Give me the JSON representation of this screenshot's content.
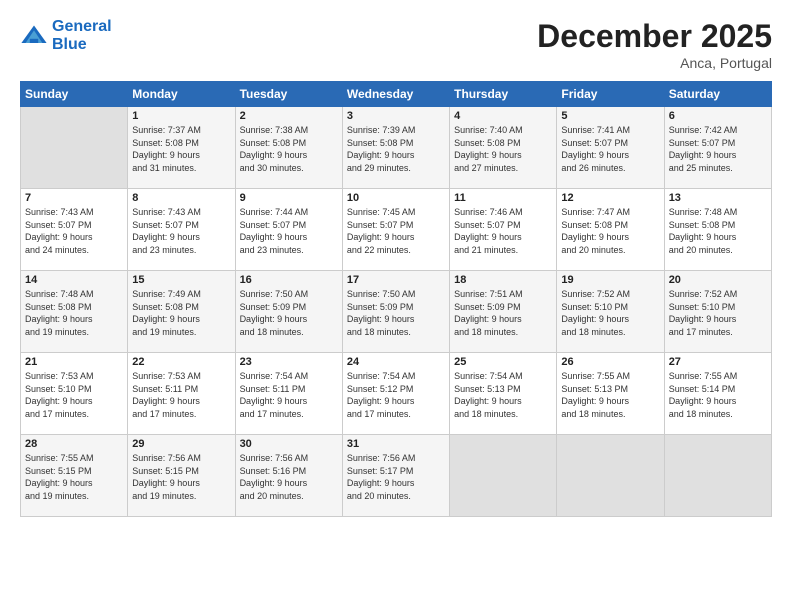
{
  "header": {
    "logo_line1": "General",
    "logo_line2": "Blue",
    "month": "December 2025",
    "location": "Anca, Portugal"
  },
  "weekdays": [
    "Sunday",
    "Monday",
    "Tuesday",
    "Wednesday",
    "Thursday",
    "Friday",
    "Saturday"
  ],
  "weeks": [
    [
      {
        "day": "",
        "info": ""
      },
      {
        "day": "1",
        "info": "Sunrise: 7:37 AM\nSunset: 5:08 PM\nDaylight: 9 hours\nand 31 minutes."
      },
      {
        "day": "2",
        "info": "Sunrise: 7:38 AM\nSunset: 5:08 PM\nDaylight: 9 hours\nand 30 minutes."
      },
      {
        "day": "3",
        "info": "Sunrise: 7:39 AM\nSunset: 5:08 PM\nDaylight: 9 hours\nand 29 minutes."
      },
      {
        "day": "4",
        "info": "Sunrise: 7:40 AM\nSunset: 5:08 PM\nDaylight: 9 hours\nand 27 minutes."
      },
      {
        "day": "5",
        "info": "Sunrise: 7:41 AM\nSunset: 5:07 PM\nDaylight: 9 hours\nand 26 minutes."
      },
      {
        "day": "6",
        "info": "Sunrise: 7:42 AM\nSunset: 5:07 PM\nDaylight: 9 hours\nand 25 minutes."
      }
    ],
    [
      {
        "day": "7",
        "info": "Sunrise: 7:43 AM\nSunset: 5:07 PM\nDaylight: 9 hours\nand 24 minutes."
      },
      {
        "day": "8",
        "info": "Sunrise: 7:43 AM\nSunset: 5:07 PM\nDaylight: 9 hours\nand 23 minutes."
      },
      {
        "day": "9",
        "info": "Sunrise: 7:44 AM\nSunset: 5:07 PM\nDaylight: 9 hours\nand 23 minutes."
      },
      {
        "day": "10",
        "info": "Sunrise: 7:45 AM\nSunset: 5:07 PM\nDaylight: 9 hours\nand 22 minutes."
      },
      {
        "day": "11",
        "info": "Sunrise: 7:46 AM\nSunset: 5:07 PM\nDaylight: 9 hours\nand 21 minutes."
      },
      {
        "day": "12",
        "info": "Sunrise: 7:47 AM\nSunset: 5:08 PM\nDaylight: 9 hours\nand 20 minutes."
      },
      {
        "day": "13",
        "info": "Sunrise: 7:48 AM\nSunset: 5:08 PM\nDaylight: 9 hours\nand 20 minutes."
      }
    ],
    [
      {
        "day": "14",
        "info": "Sunrise: 7:48 AM\nSunset: 5:08 PM\nDaylight: 9 hours\nand 19 minutes."
      },
      {
        "day": "15",
        "info": "Sunrise: 7:49 AM\nSunset: 5:08 PM\nDaylight: 9 hours\nand 19 minutes."
      },
      {
        "day": "16",
        "info": "Sunrise: 7:50 AM\nSunset: 5:09 PM\nDaylight: 9 hours\nand 18 minutes."
      },
      {
        "day": "17",
        "info": "Sunrise: 7:50 AM\nSunset: 5:09 PM\nDaylight: 9 hours\nand 18 minutes."
      },
      {
        "day": "18",
        "info": "Sunrise: 7:51 AM\nSunset: 5:09 PM\nDaylight: 9 hours\nand 18 minutes."
      },
      {
        "day": "19",
        "info": "Sunrise: 7:52 AM\nSunset: 5:10 PM\nDaylight: 9 hours\nand 18 minutes."
      },
      {
        "day": "20",
        "info": "Sunrise: 7:52 AM\nSunset: 5:10 PM\nDaylight: 9 hours\nand 17 minutes."
      }
    ],
    [
      {
        "day": "21",
        "info": "Sunrise: 7:53 AM\nSunset: 5:10 PM\nDaylight: 9 hours\nand 17 minutes."
      },
      {
        "day": "22",
        "info": "Sunrise: 7:53 AM\nSunset: 5:11 PM\nDaylight: 9 hours\nand 17 minutes."
      },
      {
        "day": "23",
        "info": "Sunrise: 7:54 AM\nSunset: 5:11 PM\nDaylight: 9 hours\nand 17 minutes."
      },
      {
        "day": "24",
        "info": "Sunrise: 7:54 AM\nSunset: 5:12 PM\nDaylight: 9 hours\nand 17 minutes."
      },
      {
        "day": "25",
        "info": "Sunrise: 7:54 AM\nSunset: 5:13 PM\nDaylight: 9 hours\nand 18 minutes."
      },
      {
        "day": "26",
        "info": "Sunrise: 7:55 AM\nSunset: 5:13 PM\nDaylight: 9 hours\nand 18 minutes."
      },
      {
        "day": "27",
        "info": "Sunrise: 7:55 AM\nSunset: 5:14 PM\nDaylight: 9 hours\nand 18 minutes."
      }
    ],
    [
      {
        "day": "28",
        "info": "Sunrise: 7:55 AM\nSunset: 5:15 PM\nDaylight: 9 hours\nand 19 minutes."
      },
      {
        "day": "29",
        "info": "Sunrise: 7:56 AM\nSunset: 5:15 PM\nDaylight: 9 hours\nand 19 minutes."
      },
      {
        "day": "30",
        "info": "Sunrise: 7:56 AM\nSunset: 5:16 PM\nDaylight: 9 hours\nand 20 minutes."
      },
      {
        "day": "31",
        "info": "Sunrise: 7:56 AM\nSunset: 5:17 PM\nDaylight: 9 hours\nand 20 minutes."
      },
      {
        "day": "",
        "info": ""
      },
      {
        "day": "",
        "info": ""
      },
      {
        "day": "",
        "info": ""
      }
    ]
  ]
}
